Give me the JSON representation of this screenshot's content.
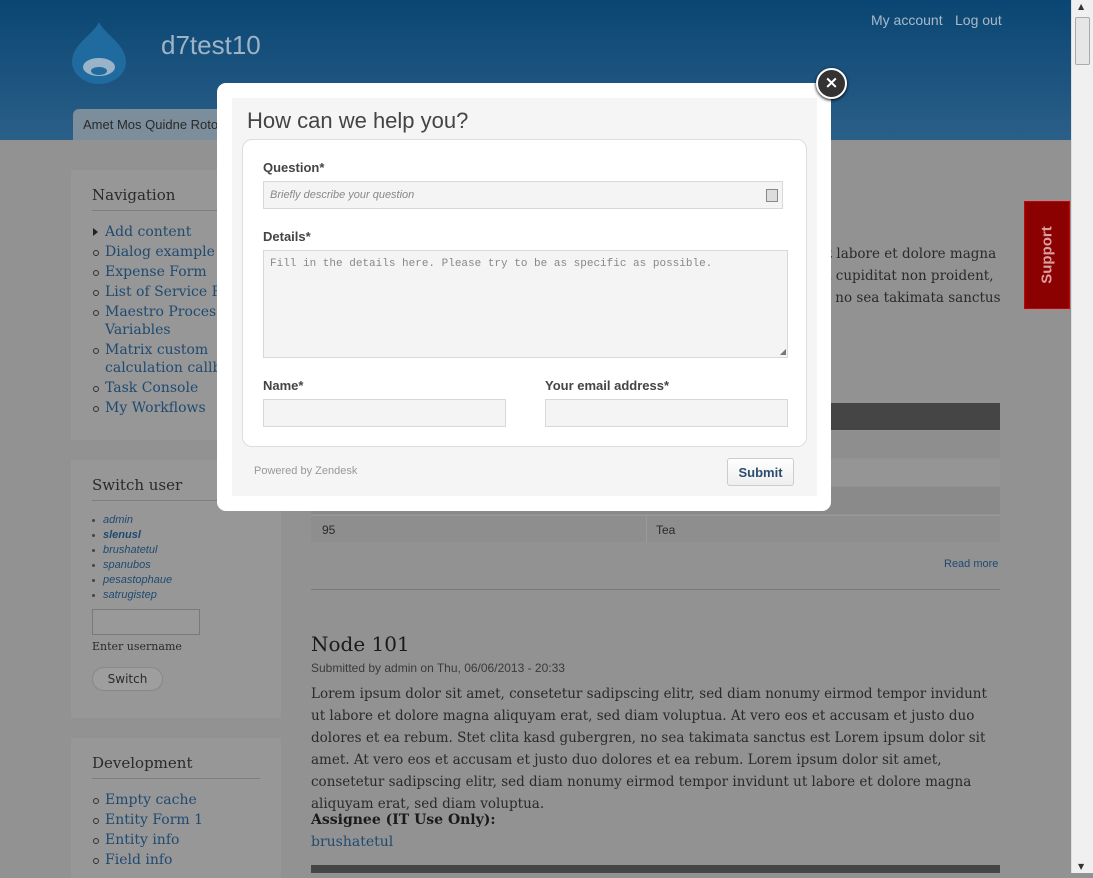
{
  "site": {
    "name": "d7test10",
    "tab": "Amet Mos Quidne Roto",
    "links": [
      "My account",
      "Log out"
    ]
  },
  "navigation": {
    "title": "Navigation",
    "items": [
      "Add content",
      "Dialog example",
      "Expense Form",
      "List of Service Req",
      "Maestro Process Variables",
      "Matrix custom calculation callbac",
      "Task Console",
      "My Workflows"
    ]
  },
  "switch_user": {
    "title": "Switch user",
    "users": [
      "admin",
      "slenusl",
      "brushatetul",
      "spanubos",
      "pesastophaue",
      "satrugistep"
    ],
    "username_label": "Enter username",
    "button": "Switch"
  },
  "development": {
    "title": "Development",
    "items": [
      "Empty cache",
      "Entity Form 1",
      "Entity info",
      "Field info"
    ]
  },
  "main": {
    "fragments": [
      "ut labore et dolore magna",
      "at cupiditat non proident,",
      "n, no sea takimata sanctus"
    ],
    "table_last_row": [
      "95",
      "Tea"
    ],
    "read_more": "Read more",
    "node": {
      "title": "Node 101",
      "submitted": "Submitted by admin on Thu, 06/06/2013 - 20:33",
      "body": "Lorem ipsum dolor sit amet, consetetur sadipscing elitr, sed diam nonumy eirmod tempor invidunt ut labore et dolore magna aliquyam erat, sed diam voluptua. At vero eos et accusam et justo duo dolores et ea rebum. Stet clita kasd gubergren, no sea takimata sanctus est Lorem ipsum dolor sit amet. At vero eos et accusam et justo duo dolores et ea rebum. Lorem ipsum dolor sit amet, consetetur sadipscing elitr, sed diam nonumy eirmod tempor invidunt ut labore et dolore magna aliquyam erat, sed diam voluptua.",
      "assignee_label": "Assignee (IT Use Only):",
      "assignee": "brushatetul"
    }
  },
  "modal": {
    "title": "How can we help you?",
    "question_label": "Question*",
    "question_placeholder": "Briefly describe your question",
    "details_label": "Details*",
    "details_placeholder": "Fill in the details here. Please try to be as specific as possible.",
    "name_label": "Name*",
    "email_label": "Your email address*",
    "powered": "Powered by Zendesk",
    "submit": "Submit",
    "close": "×"
  },
  "support_tab": "Support",
  "colors": {
    "header": "#0a4673",
    "support": "#8b0000",
    "link": "#1f4a70"
  }
}
